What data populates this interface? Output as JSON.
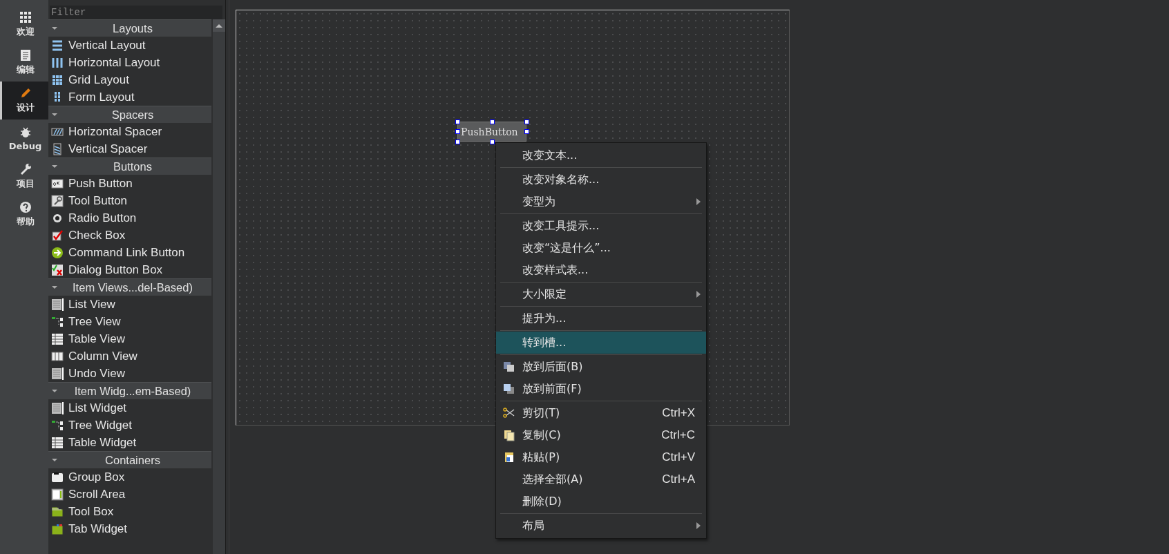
{
  "mode_bar": [
    {
      "label": "欢迎",
      "selected": false
    },
    {
      "label": "编辑",
      "selected": false
    },
    {
      "label": "设计",
      "selected": true
    },
    {
      "label": "Debug",
      "selected": false
    },
    {
      "label": "项目",
      "selected": false
    },
    {
      "label": "帮助",
      "selected": false
    }
  ],
  "widget_box": {
    "filter": {
      "placeholder": "Filter"
    },
    "sections": [
      {
        "title": "Layouts",
        "expanded": true,
        "items": [
          "Vertical Layout",
          "Horizontal Layout",
          "Grid Layout",
          "Form Layout"
        ]
      },
      {
        "title": "Spacers",
        "expanded": true,
        "items": [
          "Horizontal Spacer",
          "Vertical Spacer"
        ]
      },
      {
        "title": "Buttons",
        "expanded": true,
        "items": [
          "Push Button",
          "Tool Button",
          "Radio Button",
          "Check Box",
          "Command Link Button",
          "Dialog Button Box"
        ]
      },
      {
        "title": "Item Views...del-Based)",
        "expanded": true,
        "items": [
          "List View",
          "Tree View",
          "Table View",
          "Column View",
          "Undo View"
        ]
      },
      {
        "title": "Item Widg...em-Based)",
        "expanded": true,
        "items": [
          "List Widget",
          "Tree Widget",
          "Table Widget"
        ]
      },
      {
        "title": "Containers",
        "expanded": true,
        "items": [
          "Group Box",
          "Scroll Area",
          "Tool Box",
          "Tab Widget"
        ]
      }
    ]
  },
  "form": {
    "push_button": {
      "label": "PushButton",
      "selected": true
    }
  },
  "context_menu": [
    [
      {
        "label": "改变文本...",
        "submenu": false,
        "selected": false
      }
    ],
    [
      {
        "label": "改变对象名称...",
        "submenu": false,
        "selected": false
      },
      {
        "label": "变型为",
        "submenu": true,
        "selected": false
      }
    ],
    [
      {
        "label": "改变工具提示...",
        "submenu": false,
        "selected": false
      },
      {
        "label": "改变“这是什么”...",
        "submenu": false,
        "selected": false
      },
      {
        "label": "改变样式表...",
        "submenu": false,
        "selected": false
      }
    ],
    [
      {
        "label": "大小限定",
        "submenu": true,
        "selected": false
      }
    ],
    [
      {
        "label": "提升为...",
        "submenu": false,
        "selected": false
      }
    ],
    [
      {
        "label": "转到槽...",
        "submenu": false,
        "selected": true
      }
    ],
    [
      {
        "label": "放到后面(B)",
        "submenu": false,
        "selected": false
      },
      {
        "label": "放到前面(F)",
        "submenu": false,
        "selected": false
      }
    ],
    [
      {
        "label": "剪切(T)",
        "shortcut": "Ctrl+X",
        "submenu": false,
        "selected": false
      },
      {
        "label": "复制(C)",
        "shortcut": "Ctrl+C",
        "submenu": false,
        "selected": false
      },
      {
        "label": "粘贴(P)",
        "shortcut": "Ctrl+V",
        "submenu": false,
        "selected": false
      },
      {
        "label": "选择全部(A)",
        "shortcut": "Ctrl+A",
        "submenu": false,
        "selected": false
      },
      {
        "label": "删除(D)",
        "submenu": false,
        "selected": false
      }
    ],
    [
      {
        "label": "布局",
        "submenu": true,
        "selected": false
      }
    ]
  ]
}
